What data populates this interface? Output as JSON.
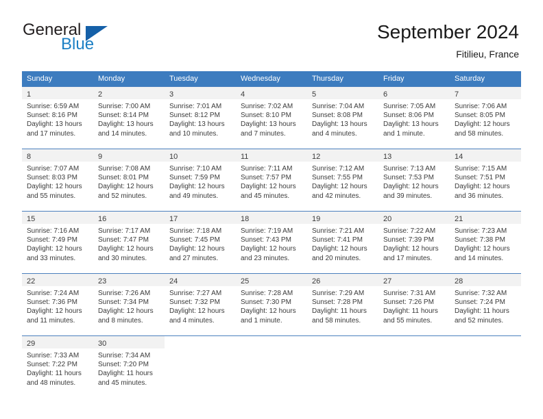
{
  "brand": {
    "line1": "General",
    "line2": "Blue",
    "triangle_color": "#1560a8",
    "blue_color": "#1b7fc4"
  },
  "header": {
    "title": "September 2024",
    "location": "Fitilieu, France"
  },
  "theme": {
    "header_row_bg": "#3d7cbf",
    "daynum_band_bg": "#f2f2f2",
    "row_divider": "#4a7fbd",
    "text": "#3a3a3a"
  },
  "weekday_headers": [
    "Sunday",
    "Monday",
    "Tuesday",
    "Wednesday",
    "Thursday",
    "Friday",
    "Saturday"
  ],
  "weeks": [
    [
      {
        "day": "1",
        "sunrise": "Sunrise: 6:59 AM",
        "sunset": "Sunset: 8:16 PM",
        "daylight_line1": "Daylight: 13 hours",
        "daylight_line2": "and 17 minutes."
      },
      {
        "day": "2",
        "sunrise": "Sunrise: 7:00 AM",
        "sunset": "Sunset: 8:14 PM",
        "daylight_line1": "Daylight: 13 hours",
        "daylight_line2": "and 14 minutes."
      },
      {
        "day": "3",
        "sunrise": "Sunrise: 7:01 AM",
        "sunset": "Sunset: 8:12 PM",
        "daylight_line1": "Daylight: 13 hours",
        "daylight_line2": "and 10 minutes."
      },
      {
        "day": "4",
        "sunrise": "Sunrise: 7:02 AM",
        "sunset": "Sunset: 8:10 PM",
        "daylight_line1": "Daylight: 13 hours",
        "daylight_line2": "and 7 minutes."
      },
      {
        "day": "5",
        "sunrise": "Sunrise: 7:04 AM",
        "sunset": "Sunset: 8:08 PM",
        "daylight_line1": "Daylight: 13 hours",
        "daylight_line2": "and 4 minutes."
      },
      {
        "day": "6",
        "sunrise": "Sunrise: 7:05 AM",
        "sunset": "Sunset: 8:06 PM",
        "daylight_line1": "Daylight: 13 hours",
        "daylight_line2": "and 1 minute."
      },
      {
        "day": "7",
        "sunrise": "Sunrise: 7:06 AM",
        "sunset": "Sunset: 8:05 PM",
        "daylight_line1": "Daylight: 12 hours",
        "daylight_line2": "and 58 minutes."
      }
    ],
    [
      {
        "day": "8",
        "sunrise": "Sunrise: 7:07 AM",
        "sunset": "Sunset: 8:03 PM",
        "daylight_line1": "Daylight: 12 hours",
        "daylight_line2": "and 55 minutes."
      },
      {
        "day": "9",
        "sunrise": "Sunrise: 7:08 AM",
        "sunset": "Sunset: 8:01 PM",
        "daylight_line1": "Daylight: 12 hours",
        "daylight_line2": "and 52 minutes."
      },
      {
        "day": "10",
        "sunrise": "Sunrise: 7:10 AM",
        "sunset": "Sunset: 7:59 PM",
        "daylight_line1": "Daylight: 12 hours",
        "daylight_line2": "and 49 minutes."
      },
      {
        "day": "11",
        "sunrise": "Sunrise: 7:11 AM",
        "sunset": "Sunset: 7:57 PM",
        "daylight_line1": "Daylight: 12 hours",
        "daylight_line2": "and 45 minutes."
      },
      {
        "day": "12",
        "sunrise": "Sunrise: 7:12 AM",
        "sunset": "Sunset: 7:55 PM",
        "daylight_line1": "Daylight: 12 hours",
        "daylight_line2": "and 42 minutes."
      },
      {
        "day": "13",
        "sunrise": "Sunrise: 7:13 AM",
        "sunset": "Sunset: 7:53 PM",
        "daylight_line1": "Daylight: 12 hours",
        "daylight_line2": "and 39 minutes."
      },
      {
        "day": "14",
        "sunrise": "Sunrise: 7:15 AM",
        "sunset": "Sunset: 7:51 PM",
        "daylight_line1": "Daylight: 12 hours",
        "daylight_line2": "and 36 minutes."
      }
    ],
    [
      {
        "day": "15",
        "sunrise": "Sunrise: 7:16 AM",
        "sunset": "Sunset: 7:49 PM",
        "daylight_line1": "Daylight: 12 hours",
        "daylight_line2": "and 33 minutes."
      },
      {
        "day": "16",
        "sunrise": "Sunrise: 7:17 AM",
        "sunset": "Sunset: 7:47 PM",
        "daylight_line1": "Daylight: 12 hours",
        "daylight_line2": "and 30 minutes."
      },
      {
        "day": "17",
        "sunrise": "Sunrise: 7:18 AM",
        "sunset": "Sunset: 7:45 PM",
        "daylight_line1": "Daylight: 12 hours",
        "daylight_line2": "and 27 minutes."
      },
      {
        "day": "18",
        "sunrise": "Sunrise: 7:19 AM",
        "sunset": "Sunset: 7:43 PM",
        "daylight_line1": "Daylight: 12 hours",
        "daylight_line2": "and 23 minutes."
      },
      {
        "day": "19",
        "sunrise": "Sunrise: 7:21 AM",
        "sunset": "Sunset: 7:41 PM",
        "daylight_line1": "Daylight: 12 hours",
        "daylight_line2": "and 20 minutes."
      },
      {
        "day": "20",
        "sunrise": "Sunrise: 7:22 AM",
        "sunset": "Sunset: 7:39 PM",
        "daylight_line1": "Daylight: 12 hours",
        "daylight_line2": "and 17 minutes."
      },
      {
        "day": "21",
        "sunrise": "Sunrise: 7:23 AM",
        "sunset": "Sunset: 7:38 PM",
        "daylight_line1": "Daylight: 12 hours",
        "daylight_line2": "and 14 minutes."
      }
    ],
    [
      {
        "day": "22",
        "sunrise": "Sunrise: 7:24 AM",
        "sunset": "Sunset: 7:36 PM",
        "daylight_line1": "Daylight: 12 hours",
        "daylight_line2": "and 11 minutes."
      },
      {
        "day": "23",
        "sunrise": "Sunrise: 7:26 AM",
        "sunset": "Sunset: 7:34 PM",
        "daylight_line1": "Daylight: 12 hours",
        "daylight_line2": "and 8 minutes."
      },
      {
        "day": "24",
        "sunrise": "Sunrise: 7:27 AM",
        "sunset": "Sunset: 7:32 PM",
        "daylight_line1": "Daylight: 12 hours",
        "daylight_line2": "and 4 minutes."
      },
      {
        "day": "25",
        "sunrise": "Sunrise: 7:28 AM",
        "sunset": "Sunset: 7:30 PM",
        "daylight_line1": "Daylight: 12 hours",
        "daylight_line2": "and 1 minute."
      },
      {
        "day": "26",
        "sunrise": "Sunrise: 7:29 AM",
        "sunset": "Sunset: 7:28 PM",
        "daylight_line1": "Daylight: 11 hours",
        "daylight_line2": "and 58 minutes."
      },
      {
        "day": "27",
        "sunrise": "Sunrise: 7:31 AM",
        "sunset": "Sunset: 7:26 PM",
        "daylight_line1": "Daylight: 11 hours",
        "daylight_line2": "and 55 minutes."
      },
      {
        "day": "28",
        "sunrise": "Sunrise: 7:32 AM",
        "sunset": "Sunset: 7:24 PM",
        "daylight_line1": "Daylight: 11 hours",
        "daylight_line2": "and 52 minutes."
      }
    ],
    [
      {
        "day": "29",
        "sunrise": "Sunrise: 7:33 AM",
        "sunset": "Sunset: 7:22 PM",
        "daylight_line1": "Daylight: 11 hours",
        "daylight_line2": "and 48 minutes."
      },
      {
        "day": "30",
        "sunrise": "Sunrise: 7:34 AM",
        "sunset": "Sunset: 7:20 PM",
        "daylight_line1": "Daylight: 11 hours",
        "daylight_line2": "and 45 minutes."
      },
      null,
      null,
      null,
      null,
      null
    ]
  ]
}
